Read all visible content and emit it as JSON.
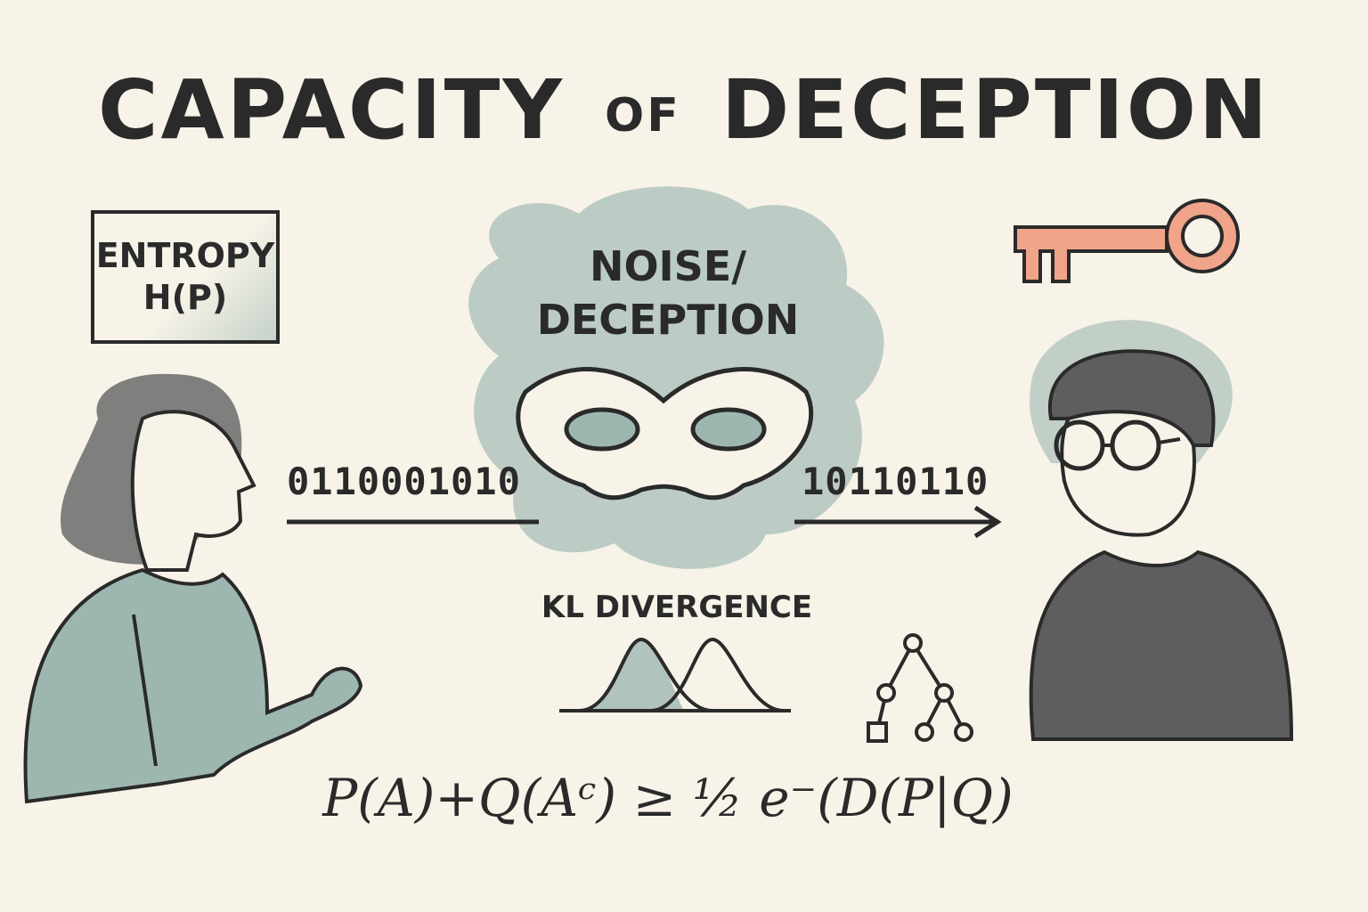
{
  "title": {
    "main_left": "CAPACITY",
    "connector": "OF",
    "main_right": "DECEPTION"
  },
  "entropy_box": {
    "line1": "ENTROPY",
    "line2": "H(P)"
  },
  "noise_cloud": {
    "line1": "NOISE/",
    "line2": "DECEPTION"
  },
  "bits_sent": "0110001010",
  "bits_received": "10110110",
  "kl_label": "KL DIVERGENCE",
  "formula": "P(A)+Q(Aᶜ) ≥ ½ e⁻(D(P|Q)",
  "icons": [
    "key-icon",
    "mask-icon",
    "tree-icon",
    "distribution-curves-icon"
  ],
  "colors": {
    "background": "#f7f3e8",
    "ink": "#2a2a2a",
    "sage": "#9db7b0",
    "key": "#f0a489",
    "sweater_dark": "#5e5e5e"
  }
}
